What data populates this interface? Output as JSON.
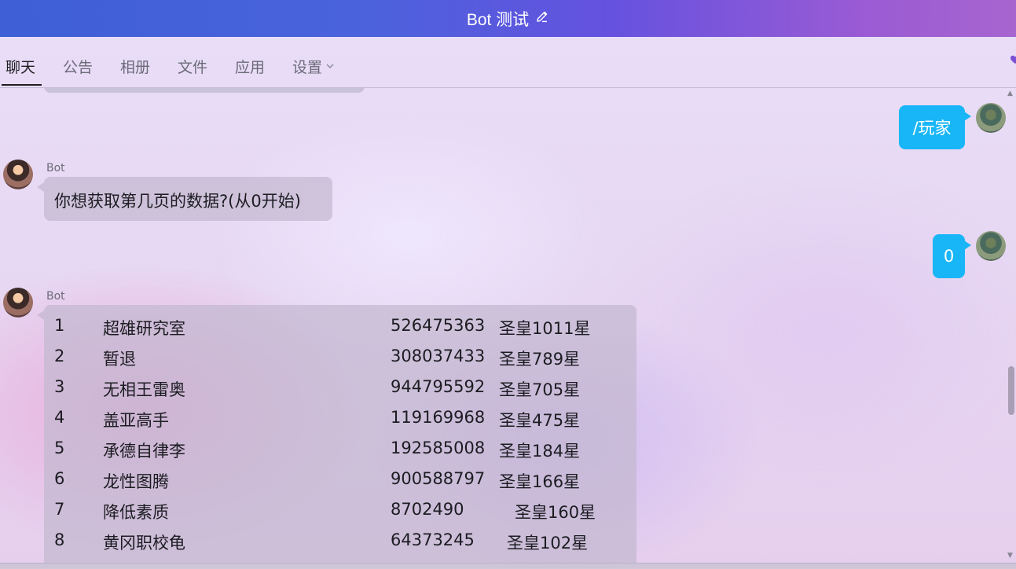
{
  "window": {
    "title": "Bot 测试"
  },
  "tabs": [
    {
      "label": "聊天",
      "active": true
    },
    {
      "label": "公告"
    },
    {
      "label": "相册"
    },
    {
      "label": "文件"
    },
    {
      "label": "应用"
    },
    {
      "label": "设置"
    }
  ],
  "messages": {
    "m1": {
      "from": "user",
      "text": "/玩家"
    },
    "m2": {
      "from": "bot",
      "sender": "Bot",
      "text": "你想获取第几页的数据?(从0开始)"
    },
    "m3": {
      "from": "user",
      "text": "0"
    },
    "m4": {
      "from": "bot",
      "sender": "Bot",
      "rows": [
        {
          "rank": "1",
          "name": "超雄研究室",
          "id": "526475363",
          "level": "圣皇1011星"
        },
        {
          "rank": "2",
          "name": "暂退",
          "id": "308037433",
          "level": "圣皇789星"
        },
        {
          "rank": "3",
          "name": "无相王雷奥",
          "id": "944795592",
          "level": "圣皇705星"
        },
        {
          "rank": "4",
          "name": "盖亚高手",
          "id": "119169968",
          "level": "圣皇475星"
        },
        {
          "rank": "5",
          "name": "承德自律李",
          "id": "192585008",
          "level": "圣皇184星"
        },
        {
          "rank": "6",
          "name": "龙性图腾",
          "id": "900588797",
          "level": "圣皇166星"
        },
        {
          "rank": "7",
          "name": "降低素质",
          "id": "8702490",
          "level": "圣皇160星"
        },
        {
          "rank": "8",
          "name": "黄冈职校龟",
          "id": "64373245",
          "level": "圣皇102星"
        }
      ]
    }
  },
  "colors": {
    "title_bar_left": "#3e5fd6",
    "title_bar_right": "#a665cf",
    "user_bubble": "#19b6f7",
    "bot_bubble": "#c3b9d0"
  },
  "icons": {
    "edit": "pencil-icon",
    "settings_dropdown": "chevron-down-icon",
    "heart": "heart-icon"
  }
}
